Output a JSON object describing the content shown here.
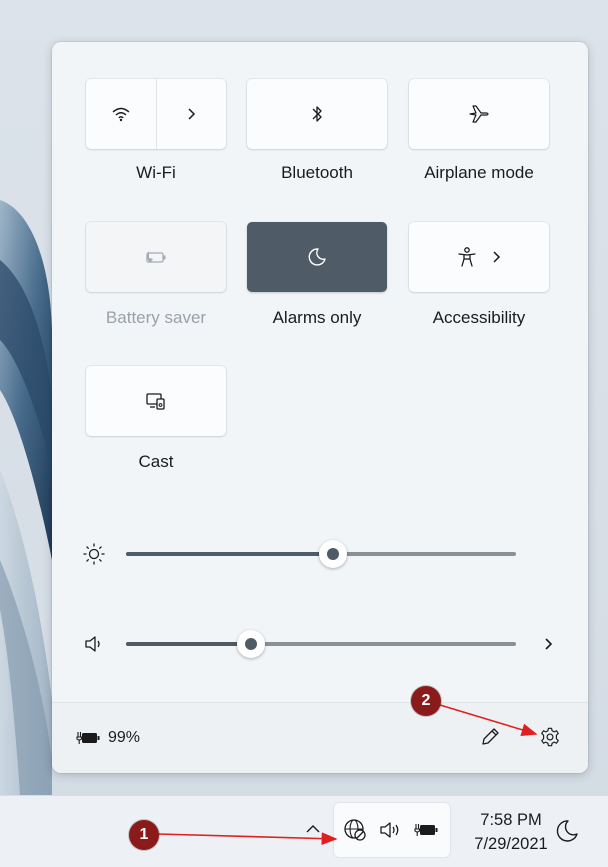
{
  "quick_settings": {
    "tiles": {
      "wifi": {
        "label": "Wi-Fi"
      },
      "bluetooth": {
        "label": "Bluetooth"
      },
      "airplane": {
        "label": "Airplane mode"
      },
      "battery_saver": {
        "label": "Battery saver",
        "state": "disabled"
      },
      "focus": {
        "label": "Alarms only",
        "state": "active"
      },
      "accessibility": {
        "label": "Accessibility"
      },
      "cast": {
        "label": "Cast"
      }
    },
    "brightness": {
      "level_percent": 53
    },
    "volume": {
      "level_percent": 32
    },
    "battery_text": "99%"
  },
  "taskbar": {
    "time": "7:58 PM",
    "date": "7/29/2021"
  },
  "annotations": [
    {
      "label": "1"
    },
    {
      "label": "2"
    }
  ],
  "colors": {
    "accent_active_tile": "#4f5b66",
    "annotation": "#8b1b1b",
    "arrow": "#e02020"
  }
}
